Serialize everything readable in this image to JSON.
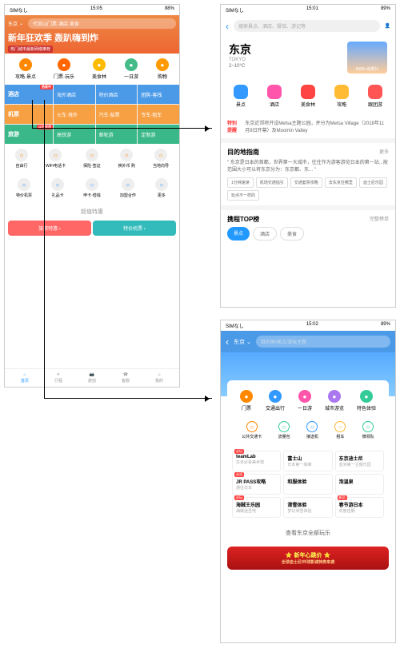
{
  "sb": {
    "car": "SIMなし",
    "bat": "88%"
  },
  "p1": {
    "time": "15:05",
    "loc": "东京",
    "srch": "代官山门票·酒店·美食",
    "ban": "新年狂欢季 轰趴嗨到炸",
    "sub": "热门城市最新网络推荐",
    "top": [
      {
        "l": "攻略·景点",
        "c": "#f80"
      },
      {
        "l": "门票·玩乐",
        "c": "#f60"
      },
      {
        "l": "美食林",
        "c": "#fb0"
      },
      {
        "l": "一日游",
        "c": "#4b8"
      },
      {
        "l": "购物",
        "c": "#f90"
      }
    ],
    "grid": [
      [
        "酒店",
        "海外酒店",
        "特价酒店",
        "团购·客栈"
      ],
      [
        "机票",
        "火车·境外",
        "汽车·船票",
        "专车·租车"
      ],
      [
        "旅游",
        "高铁游",
        "邮轮游",
        "定制游"
      ],
      [
        "自由行",
        "WiFi电话卡",
        "保险·签证",
        "换外币 购",
        "当地向导"
      ],
      [
        "特价机票",
        "礼品卡",
        "申卡·借钱",
        "加盟合作",
        "更多"
      ]
    ],
    "gridLbl": [
      "热卖中",
      "",
      "11日会员",
      ""
    ],
    "deal": "超值特惠",
    "tabs": [
      {
        "l": "旅游特惠",
        "c": "#f66"
      },
      {
        "l": "特价机票",
        "c": "#3bb"
      }
    ],
    "nav": [
      "首页",
      "行程",
      "旅拍",
      "客服",
      "我的"
    ]
  },
  "p2": {
    "time": "15:01",
    "bat": "89%",
    "srch": "搜索景点、酒店、餐馆、游记等",
    "title": "东京",
    "en": "TOKYO",
    "temp": "2~10°C",
    "photo": "9999+张照片",
    "cats": [
      {
        "l": "景点",
        "c": "#39f"
      },
      {
        "l": "酒店",
        "c": "#f5a"
      },
      {
        "l": "美食林",
        "c": "#f44"
      },
      {
        "l": "攻略",
        "c": "#fb3"
      },
      {
        "l": "跟团游",
        "c": "#f55"
      }
    ],
    "alertL": "特别\n提醒",
    "alertT": "东京近郊将开设Metsa主题公园，并分为Metsa Village（2018年11月9日开幕）及Moomin Valley",
    "guideT": "目的地指南",
    "more": "更多",
    "guideD": "\" 东京是日本的首都，世界第一大城市，往往作为游客游览日本的第一站...按范围大小可以将东京分为：东京都、东... \"",
    "tags": [
      "1分钟速读",
      "机场交通指引",
      "交通套票攻略",
      "去东京住哪里",
      "迪士尼乐园",
      "玩点不一样的"
    ],
    "rankT": "携程TOP榜",
    "rankM": "完整榜单",
    "rank": [
      "景点",
      "酒店",
      "美食"
    ]
  },
  "p3": {
    "time": "15:02",
    "bat": "89%",
    "loc": "东京",
    "srch": "目的地/景点/游玩主题",
    "top": [
      {
        "l": "门票",
        "c": "#f80"
      },
      {
        "l": "交通出行",
        "c": "#39f"
      },
      {
        "l": "一日游",
        "c": "#f5a"
      },
      {
        "l": "城市游览",
        "c": "#a7e"
      },
      {
        "l": "特色体验",
        "c": "#3c9"
      }
    ],
    "row2": [
      {
        "l": "公共交通卡",
        "c": "#f80"
      },
      {
        "l": "流量包",
        "c": "#3c9"
      },
      {
        "l": "接送机",
        "c": "#39f"
      },
      {
        "l": "租车",
        "c": "#fb3"
      },
      {
        "l": "微领队",
        "c": "#3c9"
      }
    ],
    "grid": [
      {
        "t": "teamLab",
        "s": "东京必看美术馆",
        "b": "必玩"
      },
      {
        "t": "富士山",
        "s": "日本第一高峰",
        "b": ""
      },
      {
        "t": "东京迪士尼",
        "s": "亚洲第一主题乐园",
        "b": ""
      },
      {
        "t": "JR PASS攻略",
        "s": "通往日本",
        "b": "必读"
      },
      {
        "t": "和服体验",
        "s": "",
        "b": ""
      },
      {
        "t": "泡温泉",
        "s": "",
        "b": ""
      },
      {
        "t": "海贼王乐园",
        "s": "海贼迷圣地",
        "b": "必玩"
      },
      {
        "t": "滑雪体验",
        "s": "梦幻滑雪体验",
        "b": ""
      },
      {
        "t": "春节游日本",
        "s": "欢度佳期",
        "b": "新品"
      }
    ],
    "all": "查看东京全部玩乐",
    "promo": "新年心跳价",
    "promoS": "全球迪士尼/环球影城特券来袭"
  }
}
